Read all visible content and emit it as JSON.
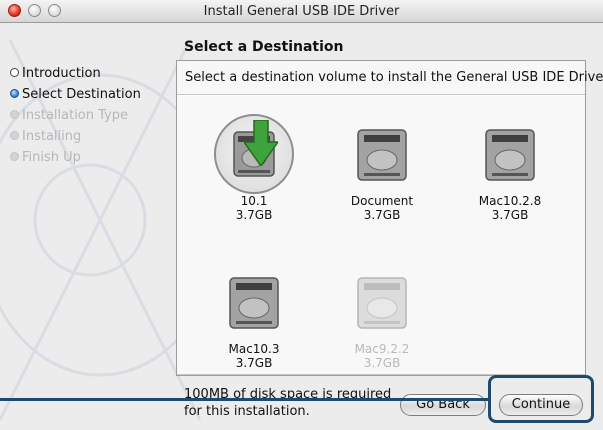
{
  "window": {
    "title": "Install General USB IDE Driver"
  },
  "sidebar": {
    "steps": [
      {
        "label": "Introduction",
        "state": "done"
      },
      {
        "label": "Select Destination",
        "state": "current"
      },
      {
        "label": "Installation Type",
        "state": "todo"
      },
      {
        "label": "Installing",
        "state": "todo"
      },
      {
        "label": "Finish Up",
        "state": "todo"
      }
    ]
  },
  "main": {
    "page_title": "Select a Destination",
    "instructions": "Select a destination volume to install the General USB IDE Driver",
    "volumes": [
      {
        "name": "10.1",
        "size": "3.7GB",
        "selected": true,
        "enabled": true
      },
      {
        "name": "Document",
        "size": "3.7GB",
        "selected": false,
        "enabled": true
      },
      {
        "name": "Mac10.2.8",
        "size": "3.7GB",
        "selected": false,
        "enabled": true
      },
      {
        "name": "Mac10.3",
        "size": "3.7GB",
        "selected": false,
        "enabled": true
      },
      {
        "name": "Mac9.2.2",
        "size": "3.7GB",
        "selected": false,
        "enabled": false
      }
    ],
    "footer_line1": "100MB of disk space is required",
    "footer_line2": "for this installation."
  },
  "buttons": {
    "back": "Go Back",
    "continue": "Continue"
  },
  "colors": {
    "annotation": "#1f4a6e",
    "selection_arrow": "#3fa33b"
  }
}
